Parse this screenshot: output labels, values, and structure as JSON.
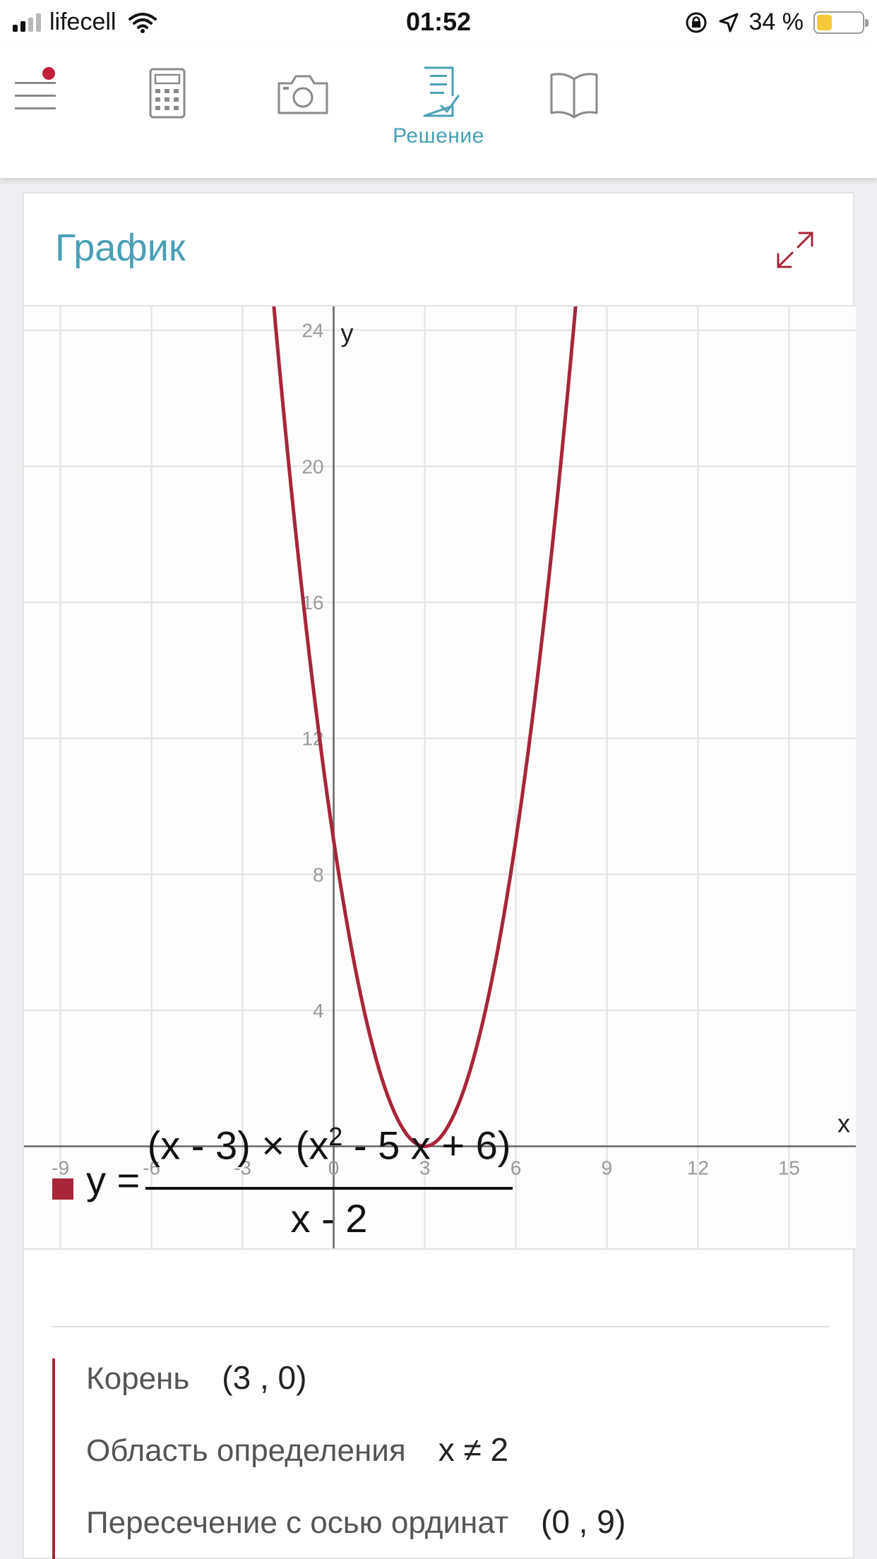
{
  "status_bar": {
    "carrier": "lifecell",
    "time": "01:52",
    "battery": "34 %",
    "battery_level": 0.34
  },
  "toolbar": {
    "items": [
      {
        "icon": "menu-icon",
        "label": "",
        "notification_dot": true
      },
      {
        "icon": "calculator-icon",
        "label": ""
      },
      {
        "icon": "camera-icon",
        "label": ""
      },
      {
        "icon": "solution-icon",
        "label": "Решение",
        "active": true
      },
      {
        "icon": "book-icon",
        "label": ""
      }
    ]
  },
  "card": {
    "title": "График",
    "expand_icon": "expand-icon"
  },
  "chart_data": {
    "type": "line",
    "xlabel": "x",
    "ylabel": "y",
    "xlim": [
      -10.2,
      17.2
    ],
    "ylim": [
      -3,
      24.7
    ],
    "x_ticks": [
      "-9",
      "-6",
      "-3",
      "0",
      "3",
      "6",
      "9",
      "12",
      "15"
    ],
    "y_ticks": [
      "4",
      "8",
      "12",
      "16",
      "20",
      "24"
    ],
    "grid": true,
    "series": [
      {
        "color": "#a8253a",
        "function": "(x-3)^2",
        "x": [
          -2,
          -1,
          0,
          1,
          2,
          3,
          4,
          5,
          6,
          7,
          8
        ],
        "values": [
          25,
          16,
          9,
          4,
          1,
          0,
          1,
          4,
          9,
          16,
          25
        ]
      }
    ]
  },
  "formula": {
    "lhs": "y =",
    "numerator_pre": "(x - 3) × (x",
    "numerator_exp": "2",
    "numerator_post": " - 5 x + 6)",
    "denominator": "x - 2",
    "color": "#a8253a"
  },
  "properties": [
    {
      "label": "Корень",
      "value": "(3 , 0)"
    },
    {
      "label": "Область определения",
      "value": "x ≠ 2"
    },
    {
      "label": "Пересечение с осью ординат",
      "value": "(0 , 9)"
    }
  ]
}
